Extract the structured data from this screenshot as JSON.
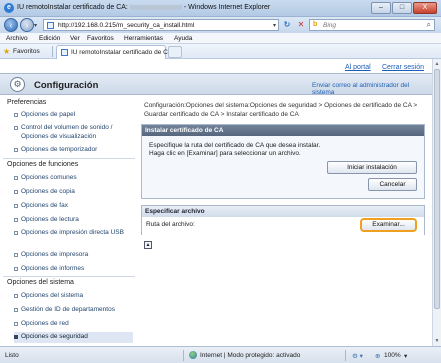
{
  "window": {
    "title_prefix": "IU remotoInstalar certificado de CA:",
    "title_suffix": "- Windows Internet Explorer",
    "min_label": "–",
    "max_label": "□",
    "close_label": "X"
  },
  "address_bar": {
    "url": "http://192.168.0.215/rn_security_ca_install.html",
    "search_placeholder": "Bing"
  },
  "menu": [
    "Archivo",
    "Edición",
    "Ver",
    "Favoritos",
    "Herramientas",
    "Ayuda"
  ],
  "favorites": {
    "label": "Favoritos",
    "tab_title": "IU remotoInstalar certificado de CA:..."
  },
  "app": {
    "portal_link": "Al portal",
    "logout_link": "Cerrar sesión",
    "header_title": "Configuración",
    "admin_mail_link": "Enviar correo al administrador del sistema"
  },
  "sidebar": {
    "sections": [
      {
        "title": "Preferencias",
        "items": [
          "Opciones de papel",
          "Control del volumen de sonido / Opciones de visualización",
          "Opciones de temporizador"
        ]
      },
      {
        "title": "Opciones de funciones",
        "items": [
          "Opciones comunes",
          "Opciones de copia",
          "Opciones de fax",
          "Opciones de lectura",
          "Opciones de impresión directa USB",
          "Opciones de impresora",
          "Opciones de informes"
        ]
      },
      {
        "title": "Opciones del sistema",
        "items": [
          "Opciones del sistema",
          "Gestión de ID de departamentos",
          "Opciones de red",
          "Opciones de seguridad"
        ]
      }
    ],
    "active_item": "Opciones de seguridad"
  },
  "breadcrumb": "Configuración:Opciones del sistema:Opciones de seguridad > Opciones de certificado de CA > Guardar certificado de CA > Instalar certificado de CA",
  "install_panel": {
    "title": "Instalar certificado de CA",
    "instruction_1": "Especifique la ruta del certificado de CA que desea instalar.",
    "instruction_2": "Haga clic en [Examinar] para seleccionar un archivo.",
    "start_button": "Iniciar instalación",
    "cancel_button": "Cancelar"
  },
  "file_panel": {
    "title": "Especificar archivo",
    "path_label": "Ruta del archivo:",
    "browse_button": "Examinar..."
  },
  "statusbar": {
    "left": "Listo",
    "zone": "Internet | Modo protegido: activado",
    "zoom": "100%"
  }
}
